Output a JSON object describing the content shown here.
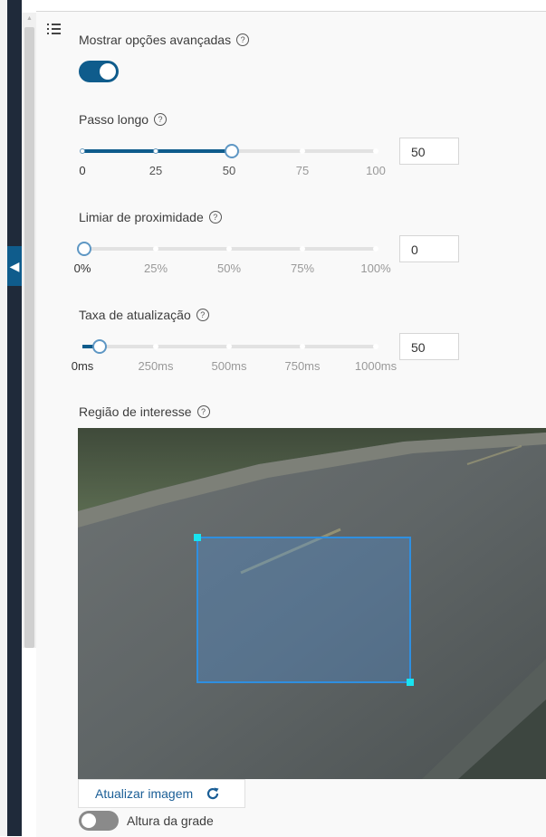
{
  "advanced": {
    "label": "Mostrar opções avançadas",
    "help_icon": "help-icon",
    "enabled": true
  },
  "long_step": {
    "label": "Passo longo",
    "value": "50",
    "range": [
      0,
      100
    ],
    "ticks": [
      "0",
      "25",
      "50",
      "75",
      "100"
    ]
  },
  "proximity": {
    "label": "Limiar de proximidade",
    "value": "0",
    "range": [
      0,
      100
    ],
    "ticks": [
      "0%",
      "25%",
      "50%",
      "75%",
      "100%"
    ]
  },
  "update_rate": {
    "label": "Taxa de atualização",
    "value": "50",
    "range": [
      0,
      1000
    ],
    "ticks": [
      "0ms",
      "250ms",
      "500ms",
      "750ms",
      "1000ms"
    ]
  },
  "roi": {
    "label": "Região de interesse",
    "accent": "#2f8fe0",
    "handle_color": "#19e3f0"
  },
  "refresh": {
    "label": "Atualizar imagem",
    "icon": "refresh-icon"
  },
  "grid_height": {
    "label": "Altura da grade",
    "enabled": false
  },
  "colors": {
    "primary": "#0f5c8c",
    "nav": "#1f2a3a"
  }
}
